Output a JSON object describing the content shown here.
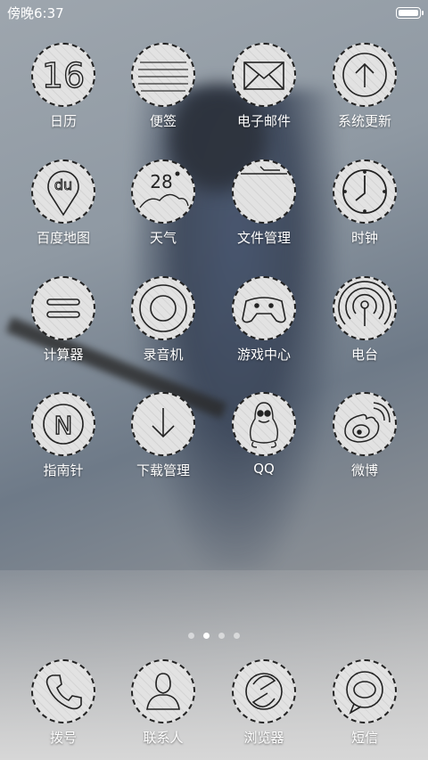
{
  "status_bar": {
    "time": "傍晚6:37"
  },
  "apps": [
    {
      "label": "日历",
      "icon": "calendar-icon",
      "day": "16"
    },
    {
      "label": "便签",
      "icon": "notes-icon"
    },
    {
      "label": "电子邮件",
      "icon": "mail-icon"
    },
    {
      "label": "系统更新",
      "icon": "update-icon"
    },
    {
      "label": "百度地图",
      "icon": "baidu-map-icon",
      "logo_text": "du"
    },
    {
      "label": "天气",
      "icon": "weather-icon",
      "temp": "28"
    },
    {
      "label": "文件管理",
      "icon": "folder-icon"
    },
    {
      "label": "时钟",
      "icon": "clock-icon"
    },
    {
      "label": "计算器",
      "icon": "calculator-icon"
    },
    {
      "label": "录音机",
      "icon": "recorder-icon"
    },
    {
      "label": "游戏中心",
      "icon": "gamepad-icon"
    },
    {
      "label": "电台",
      "icon": "radio-icon"
    },
    {
      "label": "指南针",
      "icon": "compass-icon",
      "letter": "N"
    },
    {
      "label": "下载管理",
      "icon": "download-icon"
    },
    {
      "label": "QQ",
      "icon": "qq-penguin-icon"
    },
    {
      "label": "微博",
      "icon": "weibo-icon"
    }
  ],
  "page_indicator": {
    "count": 4,
    "active": 1
  },
  "dock": [
    {
      "label": "拨号",
      "icon": "phone-icon"
    },
    {
      "label": "联系人",
      "icon": "contacts-icon"
    },
    {
      "label": "浏览器",
      "icon": "browser-icon"
    },
    {
      "label": "短信",
      "icon": "message-icon"
    }
  ]
}
